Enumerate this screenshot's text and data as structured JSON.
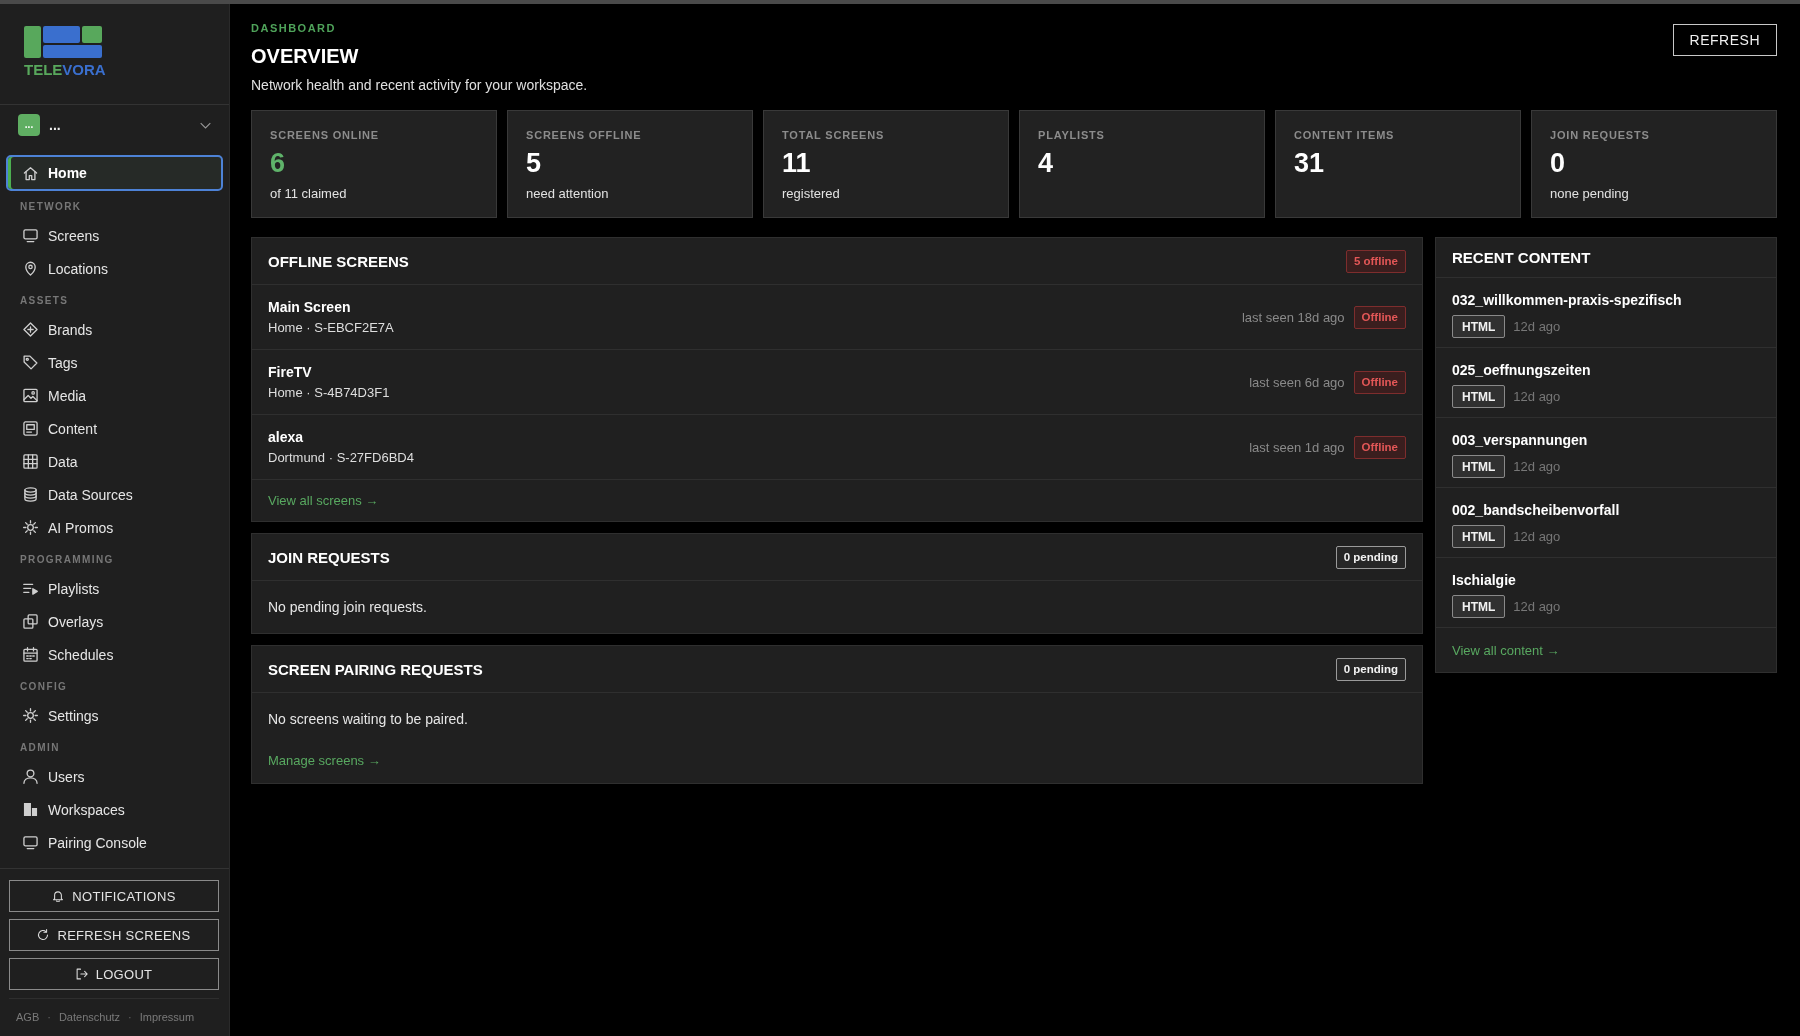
{
  "logo": {
    "wordmark": [
      {
        "text": "TELE",
        "color": "#58a85c"
      },
      {
        "text": "VORA",
        "color": "#3a6fce"
      }
    ]
  },
  "workspace": {
    "avatar": "...",
    "name": "..."
  },
  "nav": [
    {
      "items": [
        {
          "label": "Home",
          "selected": true
        }
      ]
    },
    {
      "heading": "NETWORK",
      "items": [
        {
          "label": "Screens",
          "selected": false
        },
        {
          "label": "Locations",
          "selected": false
        }
      ]
    },
    {
      "heading": "ASSETS",
      "items": [
        {
          "label": "Brands",
          "selected": false
        },
        {
          "label": "Tags",
          "selected": false
        },
        {
          "label": "Media",
          "selected": false
        },
        {
          "label": "Content",
          "selected": false
        },
        {
          "label": "Data",
          "selected": false
        },
        {
          "label": "Data Sources",
          "selected": false
        },
        {
          "label": "AI Promos",
          "selected": false
        }
      ]
    },
    {
      "heading": "PROGRAMMING",
      "items": [
        {
          "label": "Playlists",
          "selected": false
        },
        {
          "label": "Overlays",
          "selected": false
        },
        {
          "label": "Schedules",
          "selected": false
        }
      ]
    },
    {
      "heading": "CONFIG",
      "items": [
        {
          "label": "Settings",
          "selected": false
        }
      ]
    },
    {
      "heading": "ADMIN",
      "items": [
        {
          "label": "Users",
          "selected": false
        },
        {
          "label": "Workspaces",
          "selected": false
        },
        {
          "label": "Pairing Console",
          "selected": false
        }
      ]
    }
  ],
  "sidebar_actions": [
    "NOTIFICATIONS",
    "REFRESH SCREENS",
    "LOGOUT"
  ],
  "footer_links": [
    "AGB",
    "Datenschutz",
    "Impressum"
  ],
  "footer_separator": "·",
  "header": {
    "eyebrow": "DASHBOARD",
    "title": "OVERVIEW",
    "subtitle": "Network health and recent activity for your workspace.",
    "button": "REFRESH"
  },
  "stats": [
    {
      "label": "SCREENS ONLINE",
      "value": "6",
      "caption": "of 11 claimed",
      "color": "#5fb36a"
    },
    {
      "label": "SCREENS OFFLINE",
      "value": "5",
      "caption": "need attention",
      "color": "#ffffff"
    },
    {
      "label": "TOTAL SCREENS",
      "value": "11",
      "caption": "registered",
      "color": "#ffffff"
    },
    {
      "label": "PLAYLISTS",
      "value": "4",
      "color": "#ffffff"
    },
    {
      "label": "CONTENT ITEMS",
      "value": "31",
      "color": "#ffffff"
    },
    {
      "label": "JOIN REQUESTS",
      "value": "0",
      "caption": "none pending",
      "color": "#ffffff"
    }
  ],
  "panels": [
    {
      "title": "OFFLINE SCREENS",
      "badge": {
        "text": "5 offline",
        "kind": "danger"
      },
      "rows": [
        {
          "name": "Main Screen",
          "detail": "Home · S-EBCF2E7A",
          "last_seen": "last seen 18d ago",
          "status": {
            "text": "Offline",
            "kind": "danger"
          }
        },
        {
          "name": "FireTV",
          "detail": "Home · S-4B74D3F1",
          "last_seen": "last seen 6d ago",
          "status": {
            "text": "Offline",
            "kind": "danger"
          }
        },
        {
          "name": "alexa",
          "detail": "Dortmund · S-27FD6BD4",
          "last_seen": "last seen 1d ago",
          "status": {
            "text": "Offline",
            "kind": "danger"
          }
        }
      ],
      "link": "View all screens →"
    },
    {
      "title": "JOIN REQUESTS",
      "badge": {
        "text": "0 pending",
        "kind": "neutral"
      },
      "message": "No pending join requests."
    },
    {
      "title": "SCREEN PAIRING REQUESTS",
      "badge": {
        "text": "0 pending",
        "kind": "neutral"
      },
      "message": "No screens waiting to be paired.",
      "link": "Manage screens →"
    }
  ],
  "recent_content": {
    "title": "RECENT CONTENT",
    "items": [
      {
        "name": "032_willkommen-praxis-spezifisch",
        "type": "HTML",
        "age": "12d ago"
      },
      {
        "name": "025_oeffnungszeiten",
        "type": "HTML",
        "age": "12d ago"
      },
      {
        "name": "003_verspannungen",
        "type": "HTML",
        "age": "12d ago"
      },
      {
        "name": "002_bandscheibenvorfall",
        "type": "HTML",
        "age": "12d ago"
      },
      {
        "name": "Ischialgie",
        "type": "HTML",
        "age": "12d ago"
      }
    ],
    "link": "View all content →"
  }
}
